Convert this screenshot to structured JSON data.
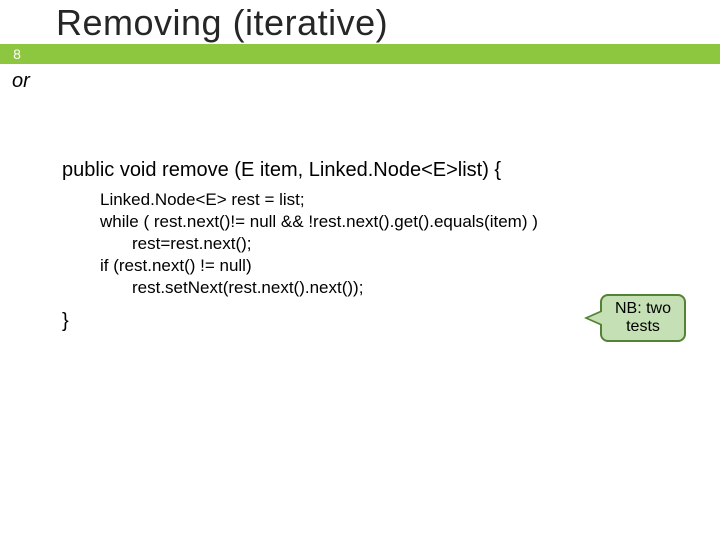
{
  "slide": {
    "title": "Removing (iterative)",
    "page_number": "8",
    "or_label": "or"
  },
  "code": {
    "signature": "public void remove (E item, Linked.Node<E>list) {",
    "line1": "Linked.Node<E> rest = list;",
    "line2": "while ( rest.next()!= null  && !rest.next().get().equals(item) )",
    "line3": "rest=rest.next();",
    "line4": "if (rest.next() != null)",
    "line5": "rest.setNext(rest.next().next());",
    "close": "}"
  },
  "callout": {
    "text": "NB: two tests"
  }
}
